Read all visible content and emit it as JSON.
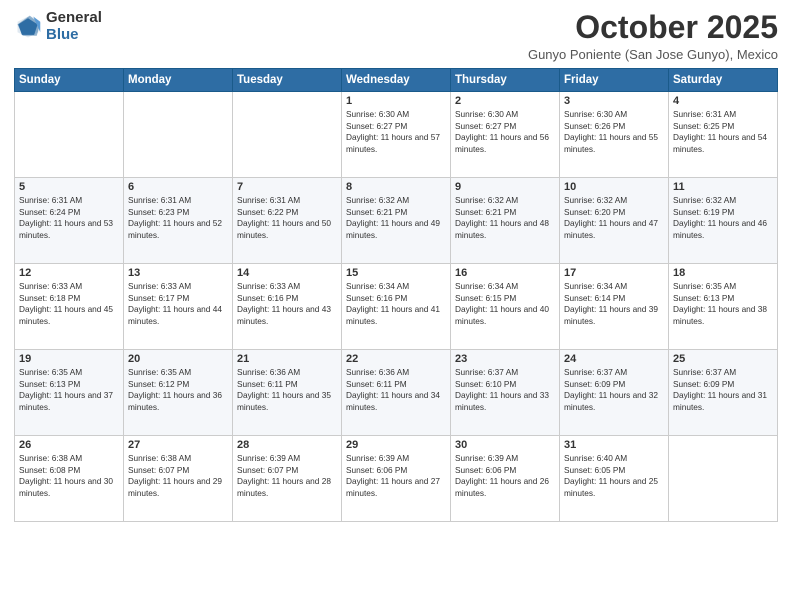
{
  "logo": {
    "line1": "General",
    "line2": "Blue"
  },
  "title": "October 2025",
  "subtitle": "Gunyo Poniente (San Jose Gunyo), Mexico",
  "weekdays": [
    "Sunday",
    "Monday",
    "Tuesday",
    "Wednesday",
    "Thursday",
    "Friday",
    "Saturday"
  ],
  "weeks": [
    [
      {
        "day": "",
        "sunrise": "",
        "sunset": "",
        "daylight": ""
      },
      {
        "day": "",
        "sunrise": "",
        "sunset": "",
        "daylight": ""
      },
      {
        "day": "",
        "sunrise": "",
        "sunset": "",
        "daylight": ""
      },
      {
        "day": "1",
        "sunrise": "Sunrise: 6:30 AM",
        "sunset": "Sunset: 6:27 PM",
        "daylight": "Daylight: 11 hours and 57 minutes."
      },
      {
        "day": "2",
        "sunrise": "Sunrise: 6:30 AM",
        "sunset": "Sunset: 6:27 PM",
        "daylight": "Daylight: 11 hours and 56 minutes."
      },
      {
        "day": "3",
        "sunrise": "Sunrise: 6:30 AM",
        "sunset": "Sunset: 6:26 PM",
        "daylight": "Daylight: 11 hours and 55 minutes."
      },
      {
        "day": "4",
        "sunrise": "Sunrise: 6:31 AM",
        "sunset": "Sunset: 6:25 PM",
        "daylight": "Daylight: 11 hours and 54 minutes."
      }
    ],
    [
      {
        "day": "5",
        "sunrise": "Sunrise: 6:31 AM",
        "sunset": "Sunset: 6:24 PM",
        "daylight": "Daylight: 11 hours and 53 minutes."
      },
      {
        "day": "6",
        "sunrise": "Sunrise: 6:31 AM",
        "sunset": "Sunset: 6:23 PM",
        "daylight": "Daylight: 11 hours and 52 minutes."
      },
      {
        "day": "7",
        "sunrise": "Sunrise: 6:31 AM",
        "sunset": "Sunset: 6:22 PM",
        "daylight": "Daylight: 11 hours and 50 minutes."
      },
      {
        "day": "8",
        "sunrise": "Sunrise: 6:32 AM",
        "sunset": "Sunset: 6:21 PM",
        "daylight": "Daylight: 11 hours and 49 minutes."
      },
      {
        "day": "9",
        "sunrise": "Sunrise: 6:32 AM",
        "sunset": "Sunset: 6:21 PM",
        "daylight": "Daylight: 11 hours and 48 minutes."
      },
      {
        "day": "10",
        "sunrise": "Sunrise: 6:32 AM",
        "sunset": "Sunset: 6:20 PM",
        "daylight": "Daylight: 11 hours and 47 minutes."
      },
      {
        "day": "11",
        "sunrise": "Sunrise: 6:32 AM",
        "sunset": "Sunset: 6:19 PM",
        "daylight": "Daylight: 11 hours and 46 minutes."
      }
    ],
    [
      {
        "day": "12",
        "sunrise": "Sunrise: 6:33 AM",
        "sunset": "Sunset: 6:18 PM",
        "daylight": "Daylight: 11 hours and 45 minutes."
      },
      {
        "day": "13",
        "sunrise": "Sunrise: 6:33 AM",
        "sunset": "Sunset: 6:17 PM",
        "daylight": "Daylight: 11 hours and 44 minutes."
      },
      {
        "day": "14",
        "sunrise": "Sunrise: 6:33 AM",
        "sunset": "Sunset: 6:16 PM",
        "daylight": "Daylight: 11 hours and 43 minutes."
      },
      {
        "day": "15",
        "sunrise": "Sunrise: 6:34 AM",
        "sunset": "Sunset: 6:16 PM",
        "daylight": "Daylight: 11 hours and 41 minutes."
      },
      {
        "day": "16",
        "sunrise": "Sunrise: 6:34 AM",
        "sunset": "Sunset: 6:15 PM",
        "daylight": "Daylight: 11 hours and 40 minutes."
      },
      {
        "day": "17",
        "sunrise": "Sunrise: 6:34 AM",
        "sunset": "Sunset: 6:14 PM",
        "daylight": "Daylight: 11 hours and 39 minutes."
      },
      {
        "day": "18",
        "sunrise": "Sunrise: 6:35 AM",
        "sunset": "Sunset: 6:13 PM",
        "daylight": "Daylight: 11 hours and 38 minutes."
      }
    ],
    [
      {
        "day": "19",
        "sunrise": "Sunrise: 6:35 AM",
        "sunset": "Sunset: 6:13 PM",
        "daylight": "Daylight: 11 hours and 37 minutes."
      },
      {
        "day": "20",
        "sunrise": "Sunrise: 6:35 AM",
        "sunset": "Sunset: 6:12 PM",
        "daylight": "Daylight: 11 hours and 36 minutes."
      },
      {
        "day": "21",
        "sunrise": "Sunrise: 6:36 AM",
        "sunset": "Sunset: 6:11 PM",
        "daylight": "Daylight: 11 hours and 35 minutes."
      },
      {
        "day": "22",
        "sunrise": "Sunrise: 6:36 AM",
        "sunset": "Sunset: 6:11 PM",
        "daylight": "Daylight: 11 hours and 34 minutes."
      },
      {
        "day": "23",
        "sunrise": "Sunrise: 6:37 AM",
        "sunset": "Sunset: 6:10 PM",
        "daylight": "Daylight: 11 hours and 33 minutes."
      },
      {
        "day": "24",
        "sunrise": "Sunrise: 6:37 AM",
        "sunset": "Sunset: 6:09 PM",
        "daylight": "Daylight: 11 hours and 32 minutes."
      },
      {
        "day": "25",
        "sunrise": "Sunrise: 6:37 AM",
        "sunset": "Sunset: 6:09 PM",
        "daylight": "Daylight: 11 hours and 31 minutes."
      }
    ],
    [
      {
        "day": "26",
        "sunrise": "Sunrise: 6:38 AM",
        "sunset": "Sunset: 6:08 PM",
        "daylight": "Daylight: 11 hours and 30 minutes."
      },
      {
        "day": "27",
        "sunrise": "Sunrise: 6:38 AM",
        "sunset": "Sunset: 6:07 PM",
        "daylight": "Daylight: 11 hours and 29 minutes."
      },
      {
        "day": "28",
        "sunrise": "Sunrise: 6:39 AM",
        "sunset": "Sunset: 6:07 PM",
        "daylight": "Daylight: 11 hours and 28 minutes."
      },
      {
        "day": "29",
        "sunrise": "Sunrise: 6:39 AM",
        "sunset": "Sunset: 6:06 PM",
        "daylight": "Daylight: 11 hours and 27 minutes."
      },
      {
        "day": "30",
        "sunrise": "Sunrise: 6:39 AM",
        "sunset": "Sunset: 6:06 PM",
        "daylight": "Daylight: 11 hours and 26 minutes."
      },
      {
        "day": "31",
        "sunrise": "Sunrise: 6:40 AM",
        "sunset": "Sunset: 6:05 PM",
        "daylight": "Daylight: 11 hours and 25 minutes."
      },
      {
        "day": "",
        "sunrise": "",
        "sunset": "",
        "daylight": ""
      }
    ]
  ]
}
